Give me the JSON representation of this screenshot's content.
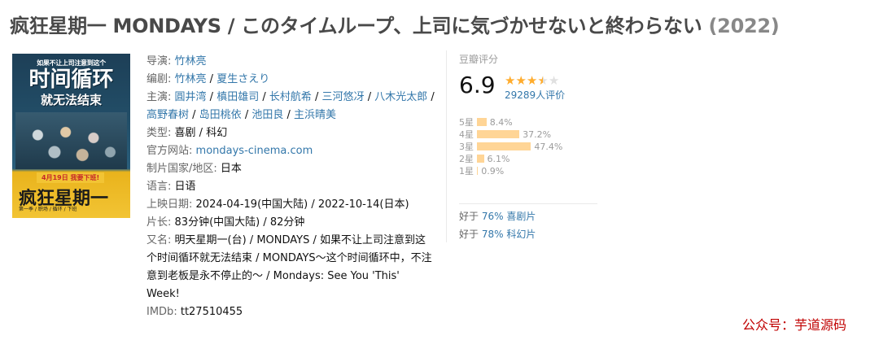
{
  "title": {
    "name": "疯狂星期一 MONDAYS / このタイムループ、上司に気づかせないと終わらない",
    "year": "(2022)"
  },
  "poster": {
    "top_line": "如果不让上司注意到这个",
    "big_line": "时间循环",
    "mid_line": "就无法结束",
    "date_badge": "4月19日 我要下班!",
    "name_text": "疯狂星期一",
    "small_text": "第一季 / 职场 / 循环 / 下班"
  },
  "info": {
    "director": {
      "label": "导演:",
      "names": [
        "竹林亮"
      ]
    },
    "writer": {
      "label": "编剧:",
      "names": [
        "竹林亮",
        "夏生さえり"
      ]
    },
    "cast": {
      "label": "主演:",
      "names": [
        "圓井湾",
        "槙田雄司",
        "长村航希",
        "三河悠冴",
        "八木光太郎",
        "高野春树",
        "岛田桃依",
        "池田良",
        "主浜晴美"
      ]
    },
    "genre": {
      "label": "类型:",
      "values": [
        "喜剧",
        "科幻"
      ]
    },
    "website": {
      "label": "官方网站:",
      "value": "mondays-cinema.com"
    },
    "country": {
      "label": "制片国家/地区:",
      "value": "日本"
    },
    "language": {
      "label": "语言:",
      "value": "日语"
    },
    "release": {
      "label": "上映日期:",
      "value": "2024-04-19(中国大陆) / 2022-10-14(日本)"
    },
    "runtime": {
      "label": "片长:",
      "value": "83分钟(中国大陆) / 82分钟"
    },
    "aka": {
      "label": "又名:",
      "value": "明天星期一(台) / MONDAYS / 如果不让上司注意到这个时间循环就无法结束 / MONDAYS～这个时间循环中，不注意到老板是永不停止的～ / Mondays: See You 'This' Week!"
    },
    "imdb": {
      "label": "IMDb:",
      "value": "tt27510455"
    }
  },
  "rating": {
    "label": "豆瓣评分",
    "score": "6.9",
    "stars_filled": 3.5,
    "votes": "29289人评价",
    "distribution": [
      {
        "level": "5星",
        "percent": "8.4%",
        "value": 8.4
      },
      {
        "level": "4星",
        "percent": "37.2%",
        "value": 37.2
      },
      {
        "level": "3星",
        "percent": "47.4%",
        "value": 47.4
      },
      {
        "level": "2星",
        "percent": "6.1%",
        "value": 6.1
      },
      {
        "level": "1星",
        "percent": "0.9%",
        "value": 0.9
      }
    ],
    "better_than": [
      {
        "prefix": "好于",
        "percent": "76%",
        "genre": "喜剧片"
      },
      {
        "prefix": "好于",
        "percent": "78%",
        "genre": "科幻片"
      }
    ]
  },
  "watermark": "公众号：芋道源码",
  "colors": {
    "link": "#3377aa",
    "bar": "#ffd596",
    "star": "#ffac2d",
    "star_empty": "#e0e0e0"
  }
}
